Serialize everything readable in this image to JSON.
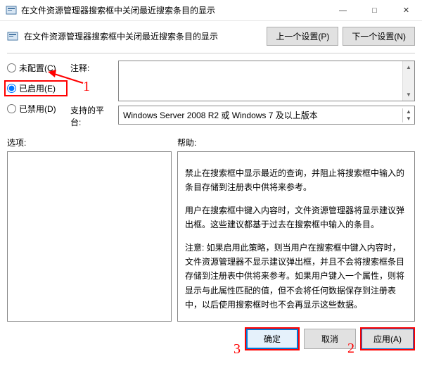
{
  "window": {
    "title": "在文件资源管理器搜索框中关闭最近搜索条目的显示",
    "minimize": "—",
    "maximize": "□",
    "close": "✕"
  },
  "header": {
    "subtitle": "在文件资源管理器搜索框中关闭最近搜索条目的显示",
    "prev": "上一个设置(P)",
    "next": "下一个设置(N)"
  },
  "config": {
    "radios": {
      "not_configured": "未配置(C)",
      "enabled": "已启用(E)",
      "disabled": "已禁用(D)"
    },
    "comment_label": "注释:",
    "platforms_label": "支持的平台:",
    "platforms_value": "Windows Server 2008 R2 或 Windows 7 及以上版本"
  },
  "sections": {
    "options": "选项:",
    "help": "帮助:"
  },
  "help_text": {
    "p1": "禁止在搜索框中显示最近的查询，并阻止将搜索框中输入的条目存储到注册表中供将来参考。",
    "p2": "用户在搜索框中键入内容时，文件资源管理器将显示建议弹出框。这些建议都基于过去在搜索框中输入的条目。",
    "p3": "注意: 如果启用此策略，则当用户在搜索框中键入内容时，文件资源管理器不显示建议弹出框，并且不会将搜索框条目存储到注册表中供将来参考。如果用户键入一个属性，则将显示与此属性匹配的值，但不会将任何数据保存到注册表中，以后使用搜索框时也不会再显示这些数据。"
  },
  "footer": {
    "ok": "确定",
    "cancel": "取消",
    "apply": "应用(A)"
  },
  "annotations": {
    "a1": "1",
    "a2": "2",
    "a3": "3"
  }
}
